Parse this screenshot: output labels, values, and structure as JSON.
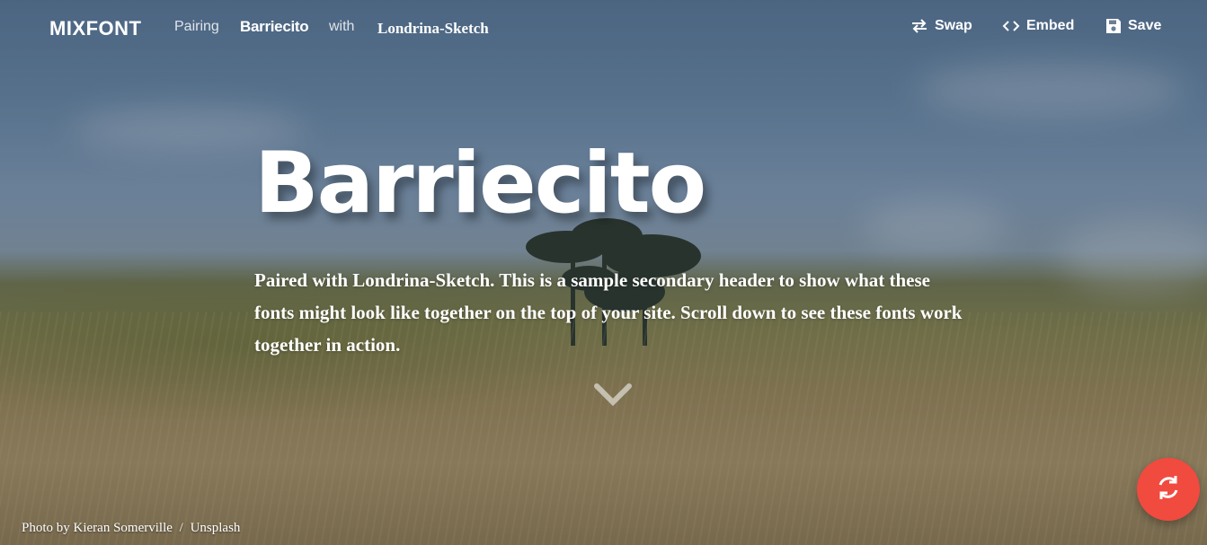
{
  "header": {
    "logo": "MIXFONT",
    "pairing_label": "Pairing",
    "primary_font": "Barriecito",
    "with_label": "with",
    "secondary_font": "Londrina-Sketch",
    "actions": {
      "swap": "Swap",
      "embed": "Embed",
      "save": "Save"
    }
  },
  "hero": {
    "title": "Barriecito",
    "subtitle": "Paired with Londrina-Sketch. This is a sample secondary header to show what these fonts might look like together on the top of your site. Scroll down to see these fonts work together in action."
  },
  "credit": {
    "prefix": "Photo by",
    "author": "Kieran Somerville",
    "separator": "/",
    "source": "Unsplash"
  },
  "icons": {
    "swap": "swap-arrows-icon",
    "embed": "code-brackets-icon",
    "save": "floppy-disk-icon",
    "scroll": "chevron-down-icon",
    "refresh": "refresh-icon"
  },
  "colors": {
    "fab": "#f14a3f",
    "text": "#ffffff"
  }
}
